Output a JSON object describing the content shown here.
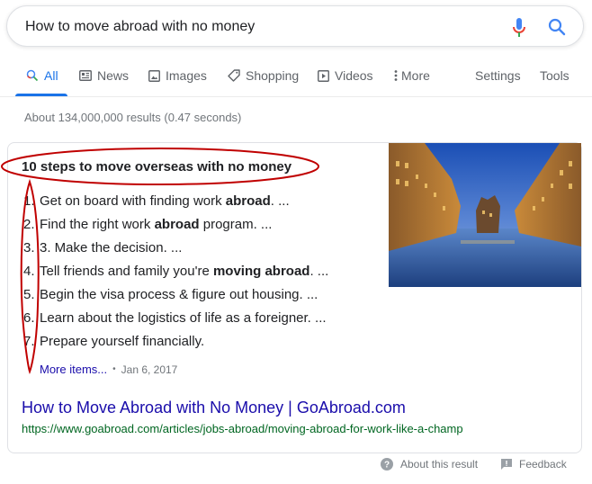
{
  "search": {
    "query": "How to move abroad with no money",
    "mic_icon": "microphone-icon",
    "search_icon": "search-icon"
  },
  "tabs": [
    {
      "label": "All",
      "icon": "search-icon",
      "active": true
    },
    {
      "label": "News",
      "icon": "news-icon"
    },
    {
      "label": "Images",
      "icon": "image-icon"
    },
    {
      "label": "Shopping",
      "icon": "tag-icon"
    },
    {
      "label": "Videos",
      "icon": "play-icon"
    },
    {
      "label": "More",
      "icon": "more-vert-icon"
    }
  ],
  "tools": {
    "settings": "Settings",
    "tools": "Tools"
  },
  "stats": "About 134,000,000 results (0.47 seconds)",
  "featured": {
    "title": "10 steps to move overseas with no money",
    "items": [
      {
        "num": "1.",
        "parts": [
          {
            "t": "Get on board with finding work "
          },
          {
            "t": "abroad",
            "b": true
          },
          {
            "t": ". ..."
          }
        ]
      },
      {
        "num": "2.",
        "parts": [
          {
            "t": "Find the right work "
          },
          {
            "t": "abroad",
            "b": true
          },
          {
            "t": " program. ..."
          }
        ]
      },
      {
        "num": "3.",
        "parts": [
          {
            "t": "3. Make the decision. ..."
          }
        ]
      },
      {
        "num": "4.",
        "parts": [
          {
            "t": "Tell friends and family you're "
          },
          {
            "t": "moving abroad",
            "b": true
          },
          {
            "t": ". ..."
          }
        ]
      },
      {
        "num": "5.",
        "parts": [
          {
            "t": "Begin the visa process & figure out housing. ..."
          }
        ]
      },
      {
        "num": "6.",
        "parts": [
          {
            "t": "Learn about the logistics of life as a foreigner. ..."
          }
        ]
      },
      {
        "num": "7.",
        "parts": [
          {
            "t": "Prepare yourself financially."
          }
        ]
      }
    ],
    "more_items": "More items...",
    "separator": "•",
    "date": "Jan 6, 2017",
    "image_alt": "Canal with illuminated warehouse buildings at dusk",
    "result_title": "How to Move Abroad with No Money | GoAbroad.com",
    "result_url": "https://www.goabroad.com/articles/jobs-abroad/moving-abroad-for-work-like-a-champ"
  },
  "footer": {
    "about": "About this result",
    "feedback": "Feedback"
  },
  "colors": {
    "link": "#1a0dab",
    "url": "#006621",
    "accent": "#1a73e8",
    "annotation": "#c00000"
  }
}
